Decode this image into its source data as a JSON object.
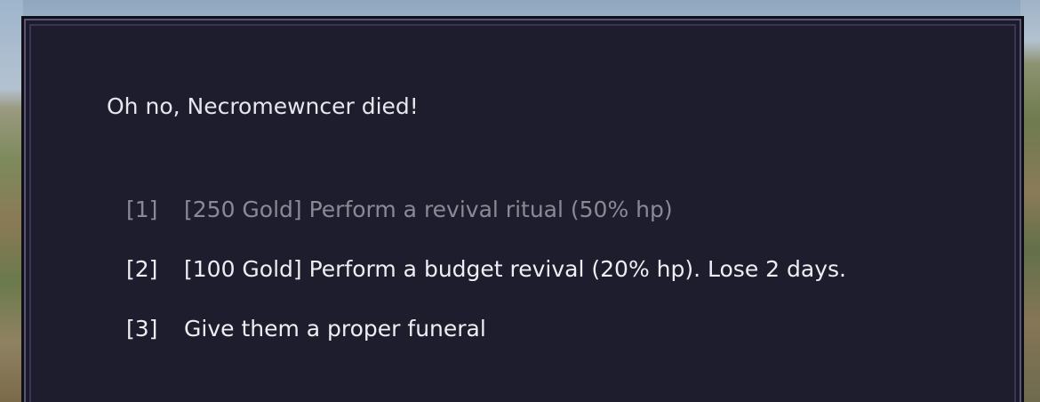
{
  "dialog": {
    "message": "Oh no, Necromewncer died!",
    "options": [
      {
        "key": "[1]",
        "label": "[250 Gold] Perform a revival ritual (50% hp)",
        "enabled": false
      },
      {
        "key": "[2]",
        "label": "[100 Gold] Perform a budget revival (20% hp). Lose 2 days.",
        "enabled": true
      },
      {
        "key": "[3]",
        "label": "Give them a proper funeral",
        "enabled": true
      }
    ]
  },
  "colors": {
    "panel_background": "#1e1d2e",
    "border_accent": "#5a5478",
    "text_enabled": "#eeeef2",
    "text_disabled": "#8a8a96"
  }
}
